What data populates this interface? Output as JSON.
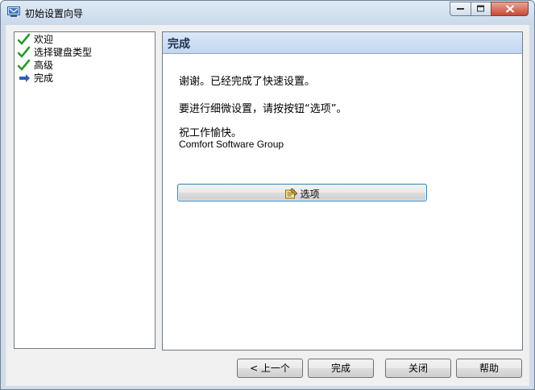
{
  "window": {
    "title": "初始设置向导"
  },
  "nav": {
    "items": [
      {
        "label": "欢迎",
        "icon": "check-icon"
      },
      {
        "label": "选择键盘类型",
        "icon": "check-icon"
      },
      {
        "label": "高级",
        "icon": "check-icon"
      },
      {
        "label": "完成",
        "icon": "arrow-right-icon"
      }
    ]
  },
  "main": {
    "title": "完成",
    "line1": "谢谢。已经完成了快速设置。",
    "line2": "要进行细微设置，请按按钮“选项”。",
    "line3": "祝工作愉快。",
    "company": "Comfort Software Group",
    "options_label": "选项"
  },
  "buttons": {
    "back": "< 上一个",
    "finish": "完成",
    "close": "关闭",
    "help": "帮助"
  },
  "colors": {
    "check": "#2a9a2a",
    "arrow": "#2f5fb3",
    "header_text": "#1b2f4e"
  }
}
